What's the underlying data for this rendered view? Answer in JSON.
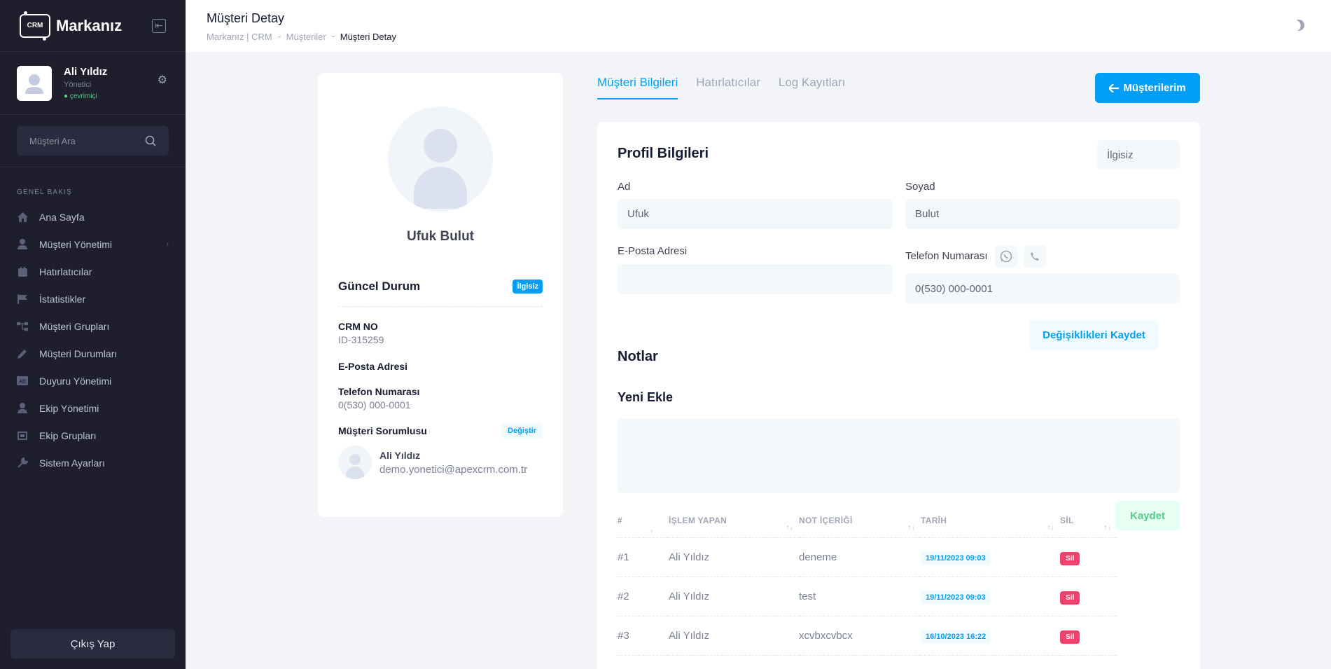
{
  "sidebar": {
    "brand": "Markanız",
    "crm_badge": "CRM",
    "user": {
      "name": "Ali Yıldız",
      "role": "Yönetici",
      "status": "● çevrimiçi"
    },
    "search_placeholder": "Müşteri Ara",
    "menu_heading": "GENEL BAKIŞ",
    "items": [
      {
        "label": "Ana Sayfa",
        "icon": "home-icon"
      },
      {
        "label": "Müşteri Yönetimi",
        "icon": "user-icon"
      },
      {
        "label": "Hatırlatıcılar",
        "icon": "calendar-icon"
      },
      {
        "label": "İstatistikler",
        "icon": "flag-icon"
      },
      {
        "label": "Müşteri Grupları",
        "icon": "hierarchy-icon"
      },
      {
        "label": "Müşteri Durumları",
        "icon": "pencil-icon"
      },
      {
        "label": "Duyuru Yönetimi",
        "icon": "ad-icon"
      },
      {
        "label": "Ekip Yönetimi",
        "icon": "user-icon"
      },
      {
        "label": "Ekip Grupları",
        "icon": "frame-icon"
      },
      {
        "label": "Sistem Ayarları",
        "icon": "wrench-icon"
      }
    ],
    "logout": "Çıkış Yap"
  },
  "header": {
    "title": "Müşteri Detay",
    "breadcrumb": [
      "Markanız | CRM",
      "Müşteriler",
      "Müşteri Detay"
    ]
  },
  "profile_card": {
    "name": "Ufuk Bulut",
    "status_title": "Güncel Durum",
    "status_badge": "İlgisiz",
    "crm_no_label": "CRM NO",
    "crm_no": "ID-315259",
    "email_label": "E-Posta Adresi",
    "phone_label": "Telefon Numarası",
    "phone": "0(530) 000-0001",
    "responsible_label": "Müşteri Sorumlusu",
    "change_label": "Değiştir",
    "responsible_name": "Ali Yıldız",
    "responsible_email": "demo.yonetici@apexcrm.com.tr"
  },
  "tabs": [
    "Müşteri Bilgileri",
    "Hatırlatıcılar",
    "Log Kayıtları"
  ],
  "back_button": "Müşterilerim",
  "form": {
    "title": "Profil Bilgileri",
    "status_value": "İlgisiz",
    "first_name_label": "Ad",
    "first_name": "Ufuk",
    "last_name_label": "Soyad",
    "last_name": "Bulut",
    "email_label": "E-Posta Adresi",
    "email": "",
    "phone_label": "Telefon Numarası",
    "phone": "0(530) 000-0001",
    "save_label": "Değişiklikleri Kaydet"
  },
  "notes": {
    "title": "Notlar",
    "add_title": "Yeni Ekle",
    "save_label": "Kaydet",
    "columns": [
      "#",
      "İŞLEM YAPAN",
      "NOT İÇERİĞİ",
      "TARİH",
      "SİL"
    ],
    "rows": [
      {
        "num": "#1",
        "user": "Ali Yıldız",
        "content": "deneme",
        "date": "19/11/2023 09:03",
        "del": "Sil"
      },
      {
        "num": "#2",
        "user": "Ali Yıldız",
        "content": "test",
        "date": "19/11/2023 09:03",
        "del": "Sil"
      },
      {
        "num": "#3",
        "user": "Ali Yıldız",
        "content": "xcvbxcvbcx",
        "date": "16/10/2023 16:22",
        "del": "Sil"
      }
    ]
  }
}
